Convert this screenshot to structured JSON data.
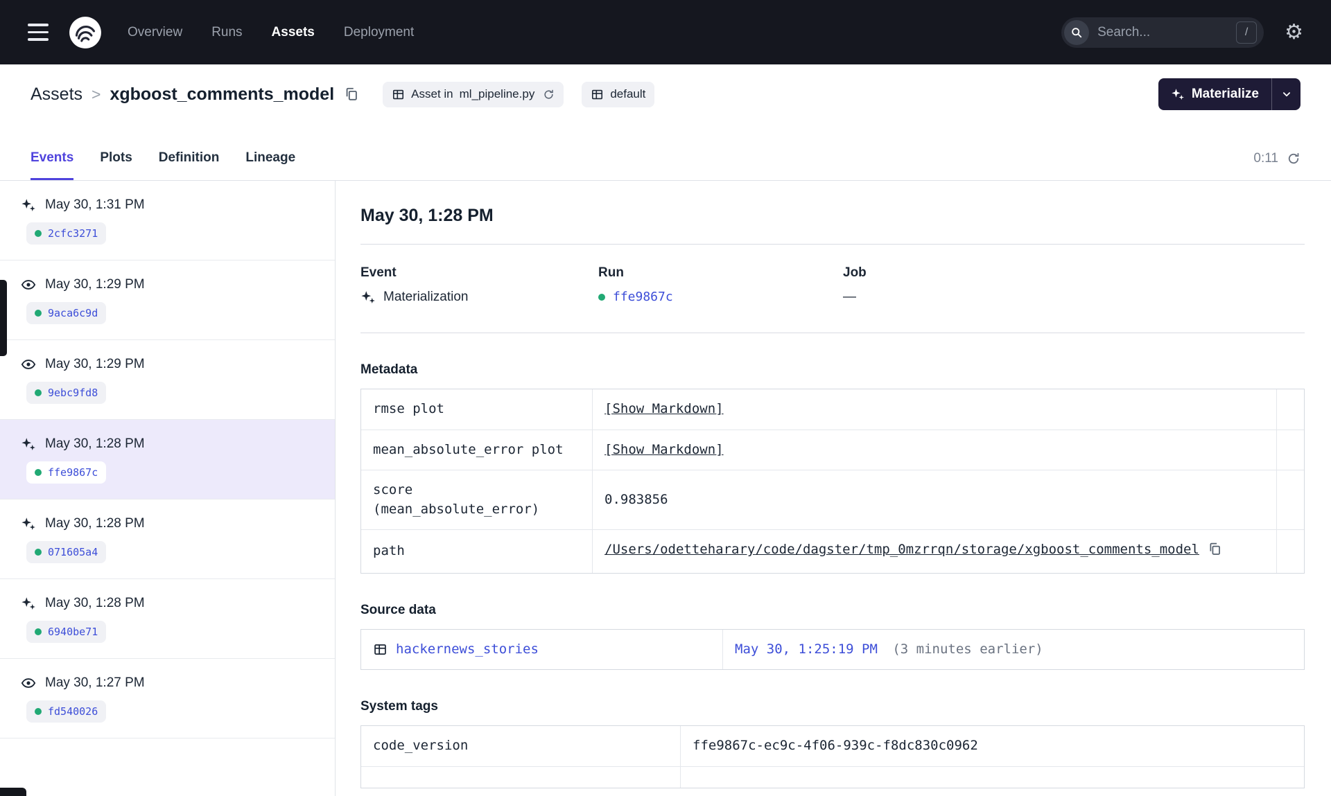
{
  "accent_color": "#4F43DD",
  "status_green": "#21A974",
  "topbar_background": "#15171F",
  "topnav": {
    "items": [
      {
        "label": "Overview",
        "active": false
      },
      {
        "label": "Runs",
        "active": false
      },
      {
        "label": "Assets",
        "active": true
      },
      {
        "label": "Deployment",
        "active": false
      }
    ],
    "search": {
      "placeholder": "Search...",
      "shortcut_key": "/"
    }
  },
  "header": {
    "breadcrumb": {
      "root": "Assets",
      "separator": ">",
      "current": "xgboost_comments_model"
    },
    "asset_tag": {
      "prefix": "Asset in",
      "link": "ml_pipeline.py"
    },
    "group_tag": {
      "label": "default"
    },
    "materialize": {
      "label": "Materialize"
    }
  },
  "tabs": {
    "items": [
      {
        "label": "Events",
        "active": true
      },
      {
        "label": "Plots",
        "active": false
      },
      {
        "label": "Definition",
        "active": false
      },
      {
        "label": "Lineage",
        "active": false
      }
    ],
    "refresh_timer": "0:11"
  },
  "sidebar": {
    "events": [
      {
        "type": "materialization",
        "time": "May 30, 1:31 PM",
        "run_id": "2cfc3271",
        "selected": false
      },
      {
        "type": "observation",
        "time": "May 30, 1:29 PM",
        "run_id": "9aca6c9d",
        "selected": false
      },
      {
        "type": "observation",
        "time": "May 30, 1:29 PM",
        "run_id": "9ebc9fd8",
        "selected": false
      },
      {
        "type": "materialization",
        "time": "May 30, 1:28 PM",
        "run_id": "ffe9867c",
        "selected": true
      },
      {
        "type": "materialization",
        "time": "May 30, 1:28 PM",
        "run_id": "071605a4",
        "selected": false
      },
      {
        "type": "materialization",
        "time": "May 30, 1:28 PM",
        "run_id": "6940be71",
        "selected": false
      },
      {
        "type": "observation",
        "time": "May 30, 1:27 PM",
        "run_id": "fd540026",
        "selected": false
      }
    ]
  },
  "detail": {
    "title": "May 30, 1:28 PM",
    "summary": {
      "event_label": "Event",
      "event_value": "Materialization",
      "run_label": "Run",
      "run_value": "ffe9867c",
      "job_label": "Job",
      "job_value": "—"
    },
    "metadata": {
      "heading": "Metadata",
      "rows": [
        {
          "key": "rmse plot",
          "value": "[Show Markdown]"
        },
        {
          "key": "mean_absolute_error plot",
          "value": "[Show Markdown]"
        },
        {
          "key": "score (mean_absolute_error)",
          "value": "0.983856"
        },
        {
          "key": "path",
          "value": "/Users/odetteharary/code/dagster/tmp_0mzrrqn/storage/xgboost_comments_model"
        }
      ]
    },
    "source_data": {
      "heading": "Source data",
      "rows": [
        {
          "asset": "hackernews_stories",
          "timestamp": "May 30, 1:25:19 PM",
          "note": "(3 minutes earlier)"
        }
      ]
    },
    "system_tags": {
      "heading": "System tags",
      "rows": [
        {
          "key": "code_version",
          "value": "ffe9867c-ec9c-4f06-939c-f8dc830c0962"
        }
      ]
    }
  }
}
